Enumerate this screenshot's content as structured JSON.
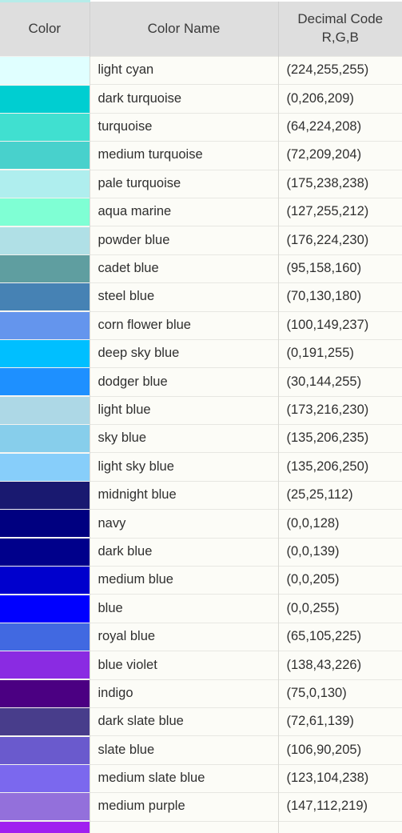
{
  "table": {
    "headers": {
      "swatch": "Color",
      "name": "Color Name",
      "code_line1": "Decimal Code",
      "code_line2": "R,G,B"
    },
    "accent_strip_color": "#b6ece9",
    "header_background": "#dedede",
    "cell_background": "#fcfcf7",
    "rows": [
      {
        "name": "light cyan",
        "code": "(224,255,255)",
        "hex": "#e0ffff"
      },
      {
        "name": "dark turquoise",
        "code": "(0,206,209)",
        "hex": "#00ced1"
      },
      {
        "name": "turquoise",
        "code": "(64,224,208)",
        "hex": "#40e0d0"
      },
      {
        "name": "medium turquoise",
        "code": "(72,209,204)",
        "hex": "#48d1cc"
      },
      {
        "name": "pale turquoise",
        "code": "(175,238,238)",
        "hex": "#afeeee"
      },
      {
        "name": "aqua marine",
        "code": "(127,255,212)",
        "hex": "#7fffd4"
      },
      {
        "name": "powder blue",
        "code": "(176,224,230)",
        "hex": "#b0e0e6"
      },
      {
        "name": "cadet blue",
        "code": "(95,158,160)",
        "hex": "#5f9ea0"
      },
      {
        "name": "steel blue",
        "code": "(70,130,180)",
        "hex": "#4682b4"
      },
      {
        "name": "corn flower blue",
        "code": "(100,149,237)",
        "hex": "#6495ed"
      },
      {
        "name": "deep sky blue",
        "code": "(0,191,255)",
        "hex": "#00bfff"
      },
      {
        "name": "dodger blue",
        "code": "(30,144,255)",
        "hex": "#1e90ff"
      },
      {
        "name": "light blue",
        "code": "(173,216,230)",
        "hex": "#add8e6"
      },
      {
        "name": "sky blue",
        "code": "(135,206,235)",
        "hex": "#87ceeb"
      },
      {
        "name": "light sky blue",
        "code": "(135,206,250)",
        "hex": "#87cefa"
      },
      {
        "name": "midnight blue",
        "code": "(25,25,112)",
        "hex": "#191970"
      },
      {
        "name": "navy",
        "code": "(0,0,128)",
        "hex": "#000080"
      },
      {
        "name": "dark blue",
        "code": "(0,0,139)",
        "hex": "#00008b"
      },
      {
        "name": "medium blue",
        "code": "(0,0,205)",
        "hex": "#0000cd"
      },
      {
        "name": "blue",
        "code": "(0,0,255)",
        "hex": "#0000ff"
      },
      {
        "name": "royal blue",
        "code": "(65,105,225)",
        "hex": "#4169e1"
      },
      {
        "name": "blue violet",
        "code": "(138,43,226)",
        "hex": "#8a2be2"
      },
      {
        "name": "indigo",
        "code": "(75,0,130)",
        "hex": "#4b0082"
      },
      {
        "name": "dark slate blue",
        "code": "(72,61,139)",
        "hex": "#483d8b"
      },
      {
        "name": "slate blue",
        "code": "(106,90,205)",
        "hex": "#6a5acd"
      },
      {
        "name": "medium slate blue",
        "code": "(123,104,238)",
        "hex": "#7b68ee"
      },
      {
        "name": "medium purple",
        "code": "(147,112,219)",
        "hex": "#9370db"
      }
    ],
    "partial_row": {
      "name": "",
      "code": "",
      "hex": "#a020f0"
    }
  }
}
